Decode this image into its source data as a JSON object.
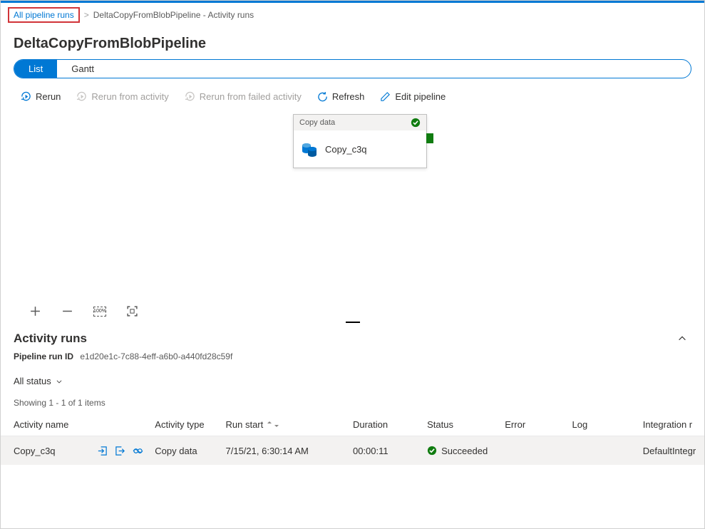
{
  "breadcrumb": {
    "link": "All pipeline runs",
    "current": "DeltaCopyFromBlobPipeline - Activity runs"
  },
  "title": "DeltaCopyFromBlobPipeline",
  "tabs": {
    "list": "List",
    "gantt": "Gantt"
  },
  "toolbar": {
    "rerun": "Rerun",
    "rerun_activity": "Rerun from activity",
    "rerun_failed": "Rerun from failed activity",
    "refresh": "Refresh",
    "edit": "Edit pipeline"
  },
  "activity_node": {
    "header": "Copy data",
    "label": "Copy_c3q"
  },
  "canvas_controls": {
    "zoom_pct": "100%"
  },
  "activity_runs": {
    "title": "Activity runs",
    "pipeline_id_label": "Pipeline run ID",
    "pipeline_id_value": "e1d20e1c-7c88-4eff-a6b0-a440fd28c59f",
    "filter": "All status",
    "showing": "Showing 1 - 1 of 1 items",
    "columns": {
      "name": "Activity name",
      "type": "Activity type",
      "start": "Run start",
      "duration": "Duration",
      "status": "Status",
      "error": "Error",
      "log": "Log",
      "integration": "Integration r"
    },
    "rows": [
      {
        "name": "Copy_c3q",
        "type": "Copy data",
        "start": "7/15/21, 6:30:14 AM",
        "duration": "00:00:11",
        "status": "Succeeded",
        "error": "",
        "log": "",
        "integration": "DefaultIntegr"
      }
    ]
  }
}
